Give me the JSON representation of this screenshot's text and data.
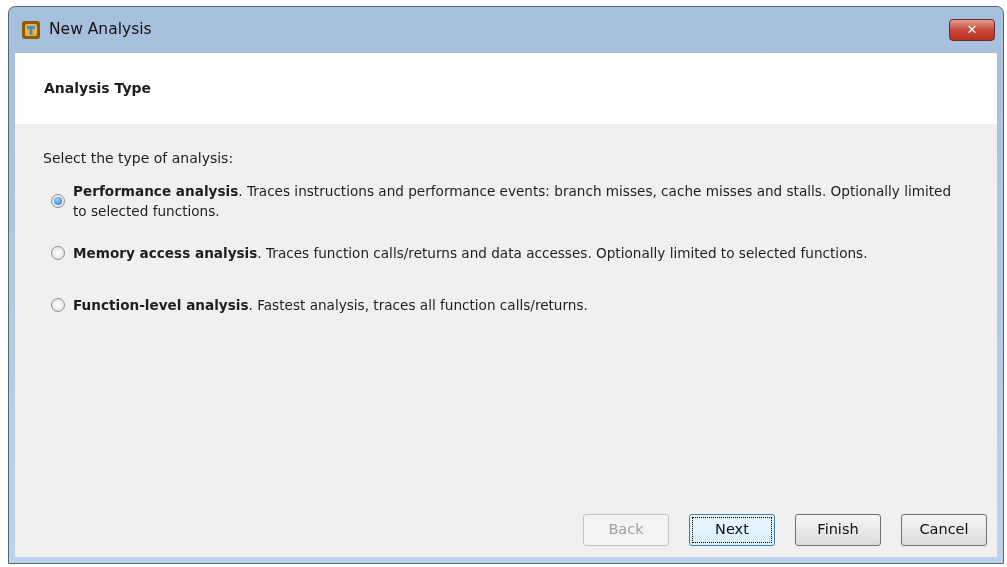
{
  "window": {
    "title": "New Analysis",
    "close_label": "✕"
  },
  "header": {
    "title": "Analysis Type"
  },
  "prompt": "Select the type of analysis:",
  "options": [
    {
      "text": "**Performance analysis**. Traces instructions and performance events: branch misses, cache misses and stalls. Optionally limited to selected functions.",
      "selected": true
    },
    {
      "text": "**Memory access analysis**. Traces function calls/returns and data accesses. Optionally limited to selected functions.",
      "selected": false
    },
    {
      "text": "**Function-level analysis**. Fastest analysis, traces all function calls/returns.",
      "selected": false
    }
  ],
  "buttons": [
    {
      "label": "Back",
      "disabled": true,
      "focused": false
    },
    {
      "label": "Next",
      "disabled": false,
      "focused": true
    },
    {
      "label": "Finish",
      "disabled": false,
      "focused": false
    },
    {
      "label": "Cancel",
      "disabled": false,
      "focused": false
    }
  ]
}
